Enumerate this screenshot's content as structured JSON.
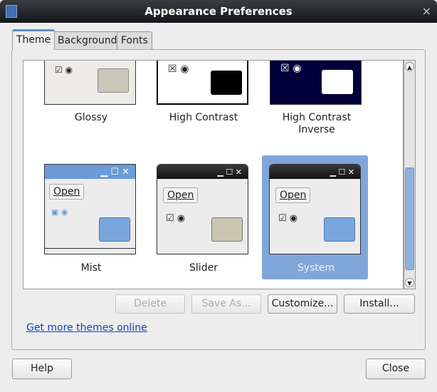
{
  "window": {
    "title": "Appearance Preferences",
    "close_glyph": "×"
  },
  "tabs": [
    {
      "label": "Theme",
      "active": true
    },
    {
      "label": "Background"
    },
    {
      "label": "Fonts"
    }
  ],
  "themes": [
    {
      "name": "Glossy"
    },
    {
      "name": "High Contrast"
    },
    {
      "name": "High Contrast Inverse"
    },
    {
      "name": "Mist",
      "open": "Open"
    },
    {
      "name": "Slider",
      "open": "Open"
    },
    {
      "name": "System",
      "open": "Open",
      "selected": true
    }
  ],
  "buttons": {
    "delete": "Delete",
    "save_as": "Save As...",
    "customize": "Customize...",
    "install": "Install...",
    "help": "Help",
    "close": "Close"
  },
  "link": "Get more themes online",
  "colors": {
    "selection": "#7fa6d9",
    "link": "#1a3fbf"
  }
}
